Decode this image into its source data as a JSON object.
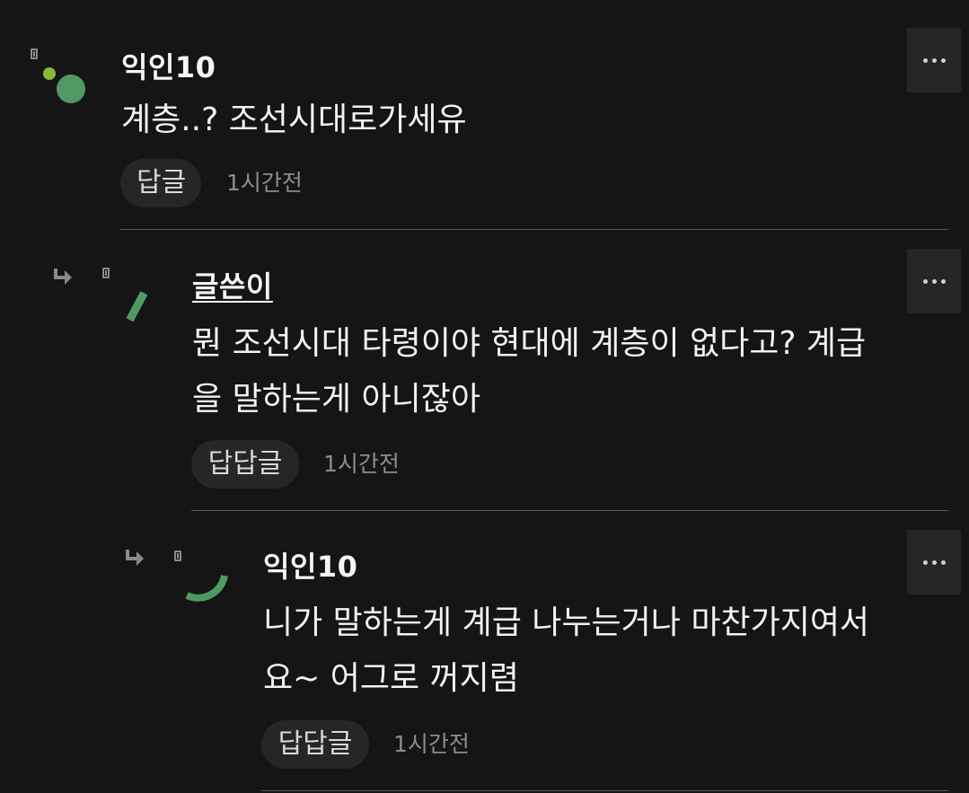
{
  "comments": [
    {
      "author": "익인10",
      "text": "계층..? 조선시대로가세유",
      "reply_label": "답글",
      "time": "1시간전",
      "more_icon": "more-horizontal-icon"
    },
    {
      "author": "글쓴이",
      "text": "뭔 조선시대 타령이야 현대에 계층이 없다고? 계급\n을 말하는게 아니잖아",
      "reply_label": "답답글",
      "time": "1시간전",
      "more_icon": "more-horizontal-icon"
    },
    {
      "author": "익인10",
      "text": "니가 말하는게 계급 나누는거나 마찬가지여서\n요~ 어그로 꺼지렴",
      "reply_label": "답답글",
      "time": "1시간전",
      "more_icon": "more-horizontal-icon"
    }
  ],
  "colors": {
    "background": "#151515",
    "avatar_green": "#4f9a64",
    "avatar_lime": "#8ab83a",
    "button_bg": "#262626"
  }
}
